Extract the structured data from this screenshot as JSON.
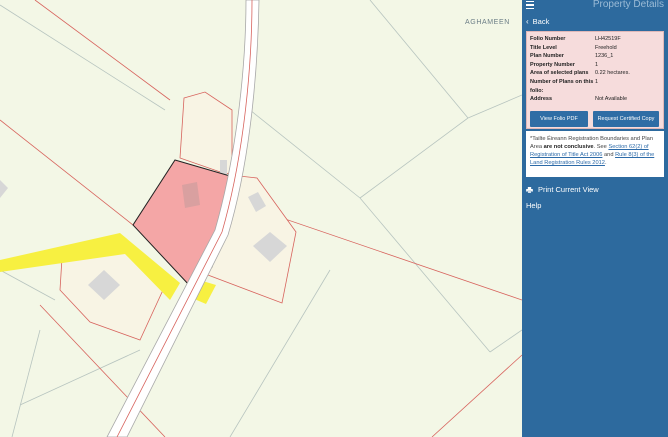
{
  "map": {
    "place_label": "AGHAMEEN"
  },
  "panel": {
    "title": "Property Details",
    "back_label": "Back",
    "details": [
      {
        "key": "Folio Number",
        "value": "LH42519F"
      },
      {
        "key": "Title Level",
        "value": "Freehold"
      },
      {
        "key": "Plan Number",
        "value": "1236_1"
      },
      {
        "key": "Property Number",
        "value": "1"
      },
      {
        "key": "Area of selected plans",
        "value": "0.22 hectares."
      },
      {
        "key": "Number of Plans on this folio:",
        "value": "1"
      },
      {
        "key": "Address",
        "value": "Not Available"
      }
    ],
    "view_folio_label": "View Folio PDF",
    "request_copy_label": "Request Certified Copy",
    "disclaimer": {
      "intro": "*Tailte Éireann Registration Boundaries and Plan Area ",
      "bold": "are not conclusive",
      "see": ". See ",
      "link1": "Section 62(2) of Registration of Title Act 2006",
      "and": " and ",
      "link2": "Rule 8(3) of the Land Registration Rules 2012",
      "end": "."
    },
    "print_label": "Print Current View",
    "help_label": "Help"
  },
  "colors": {
    "panel_bg": "#2d6a9e",
    "selected_plot": "#f4a6a6",
    "road_yellow": "#f7f041",
    "map_bg": "#f3f7e6"
  }
}
